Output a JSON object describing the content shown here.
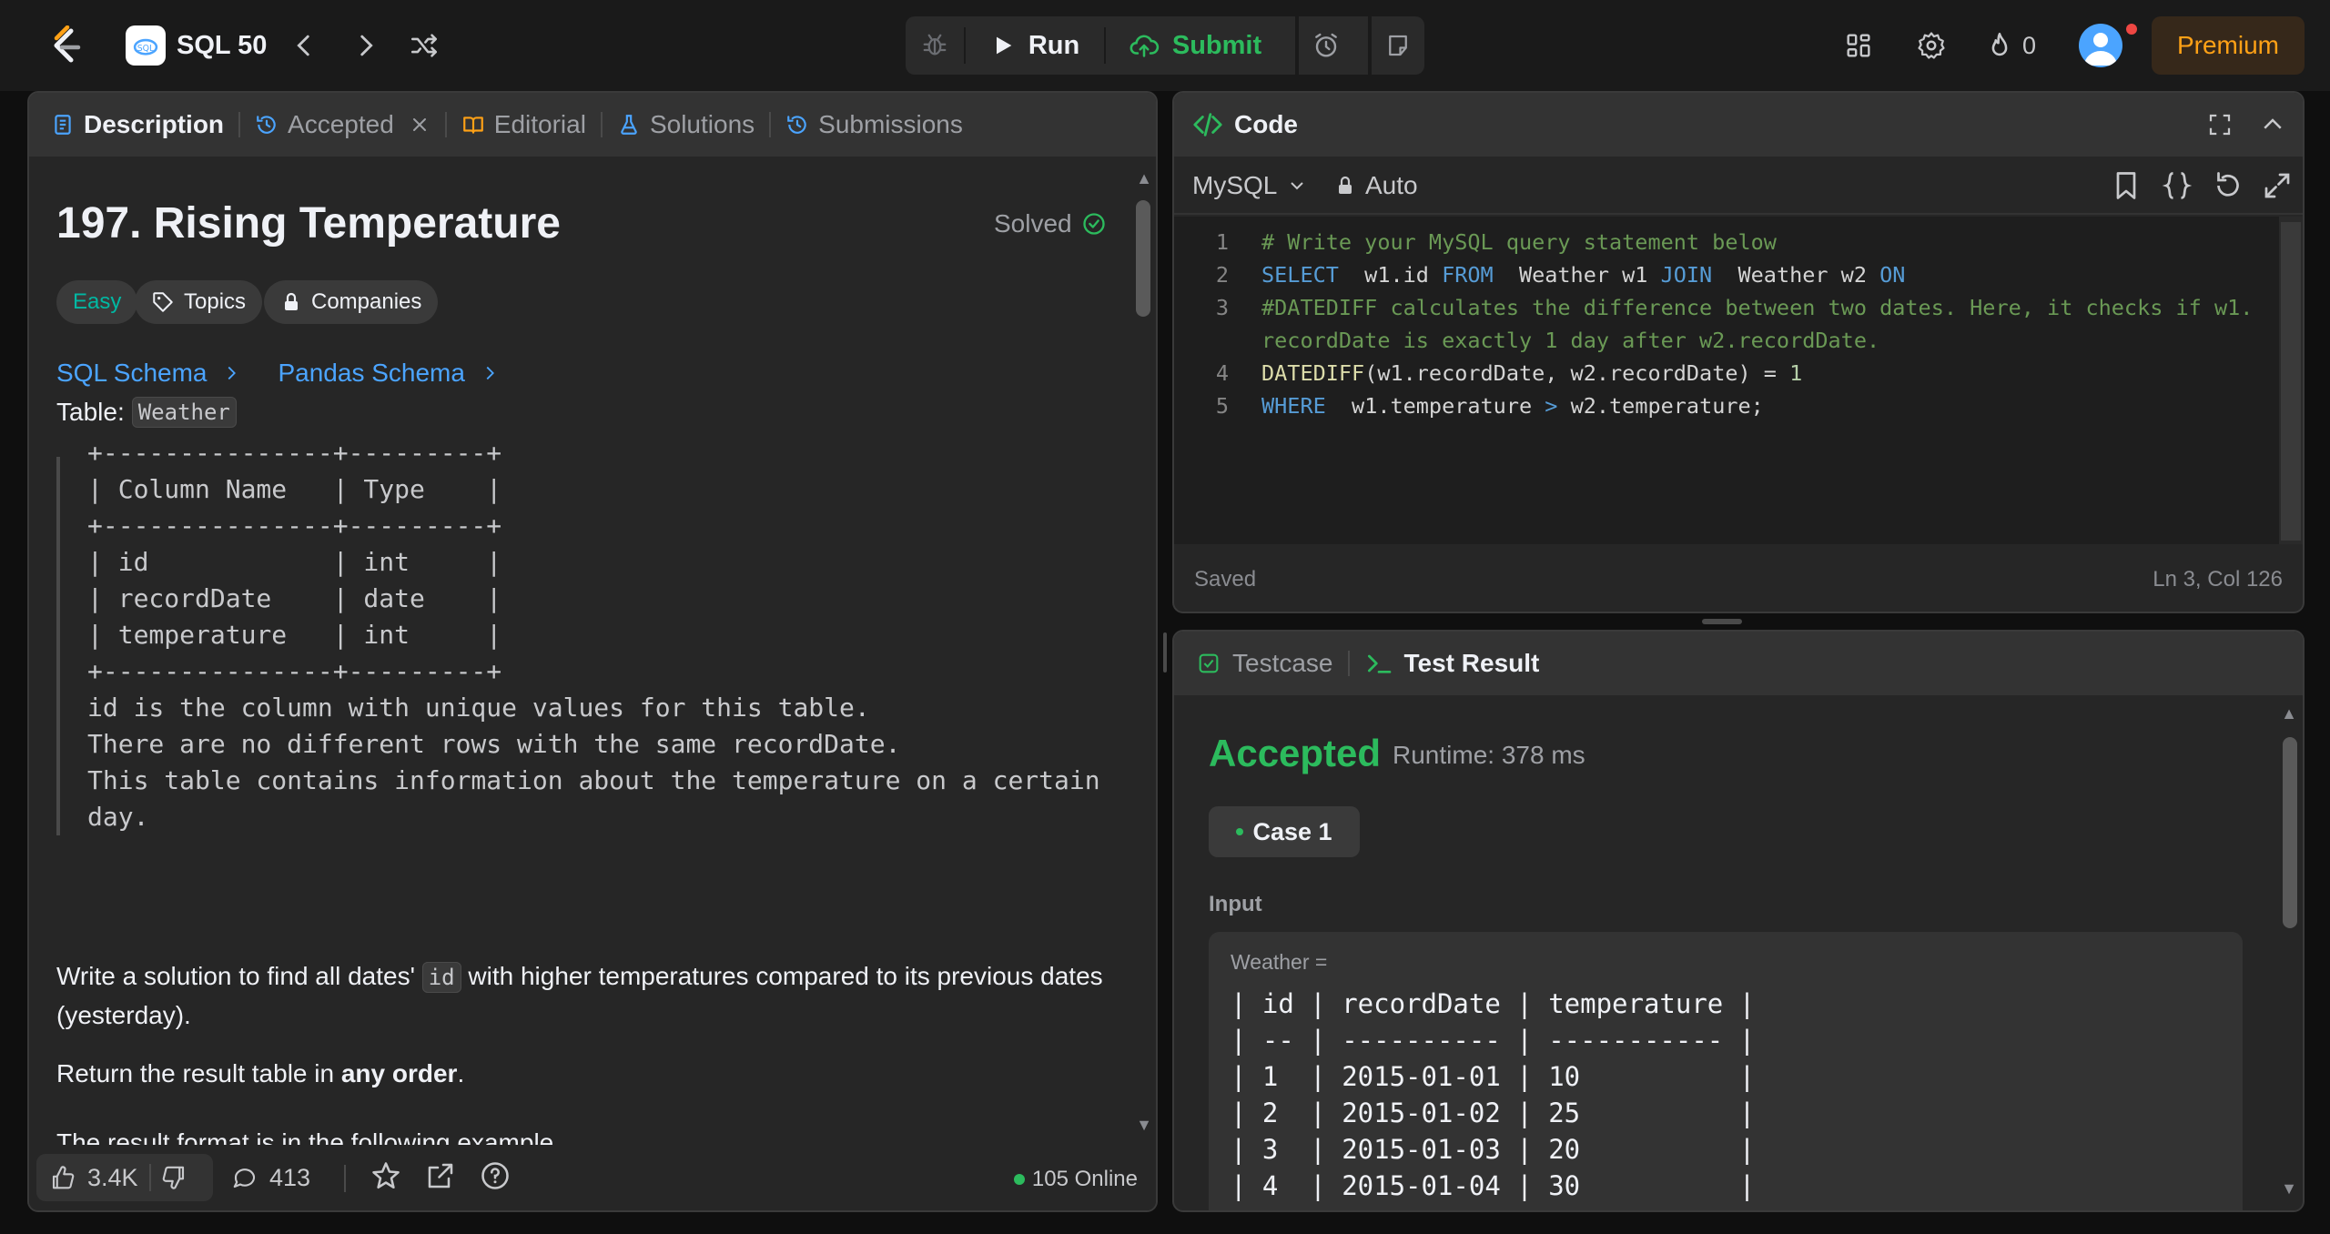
{
  "topbar": {
    "list_title": "SQL 50",
    "run_label": "Run",
    "submit_label": "Submit",
    "streak_count": "0",
    "premium_label": "Premium"
  },
  "left_tabs": [
    {
      "label": "Description"
    },
    {
      "label": "Accepted"
    },
    {
      "label": "Editorial"
    },
    {
      "label": "Solutions"
    },
    {
      "label": "Submissions"
    }
  ],
  "problem": {
    "title": "197. Rising Temperature",
    "status": "Solved",
    "difficulty": "Easy",
    "topics_label": "Topics",
    "companies_label": "Companies",
    "sql_schema": "SQL Schema",
    "pandas_schema": "Pandas Schema",
    "table_prefix": "Table:",
    "table_name": "Weather",
    "schema_text": "+---------------+---------+\n| Column Name   | Type    |\n+---------------+---------+\n| id            | int     |\n| recordDate    | date    |\n| temperature   | int     |\n+---------------+---------+\nid is the column with unique values for this table.\nThere are no different rows with the same recordDate.\nThis table contains information about the temperature on a certain day.",
    "para1_a": "Write a solution to find all dates'",
    "para1_code": "id",
    "para1_b": "with higher temperatures compared to its previous dates (yesterday).",
    "para2_a": "Return the result table in",
    "para2_bold": "any order",
    "para2_b": ".",
    "para3": "The result format is in the following example."
  },
  "left_footer": {
    "likes": "3.4K",
    "comments": "413",
    "online": "105 Online"
  },
  "code": {
    "header": "Code",
    "language": "MySQL",
    "mode": "Auto",
    "status": "Saved",
    "cursor": "Ln 3, Col 126",
    "line_numbers": [
      "1",
      "2",
      "3",
      "",
      "4",
      "5"
    ]
  },
  "result": {
    "testcase_tab": "Testcase",
    "result_tab": "Test Result",
    "verdict": "Accepted",
    "runtime": "Runtime: 378 ms",
    "case_label": "Case 1",
    "input_label": "Input",
    "input_var": "Weather =",
    "input_table": "| id | recordDate | temperature |\n| -- | ---------- | ----------- |\n| 1  | 2015-01-01 | 10          |\n| 2  | 2015-01-02 | 25          |\n| 3  | 2015-01-03 | 20          |\n| 4  | 2015-01-04 | 30          |"
  },
  "colors": {
    "accent_green": "#2cbb5d",
    "accent_orange": "#ffa116",
    "link_blue": "#4ba4ff"
  }
}
